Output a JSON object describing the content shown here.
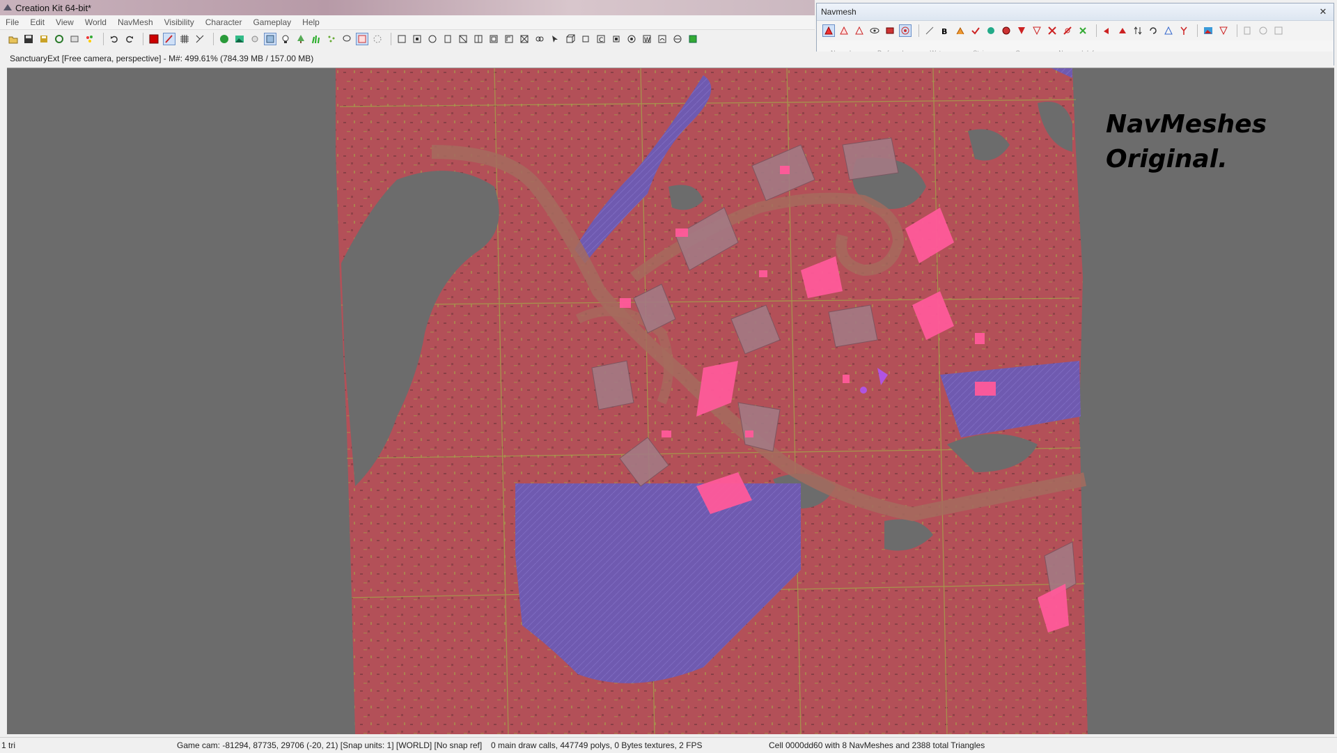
{
  "window": {
    "title": "Creation Kit 64-bit*"
  },
  "menu": {
    "items": [
      "File",
      "Edit",
      "View",
      "World",
      "NavMesh",
      "Visibility",
      "Character",
      "Gameplay",
      "Help"
    ]
  },
  "toolbar": {
    "icons": [
      "open-icon",
      "save-icon",
      "save-all-icon",
      "refresh-icon",
      "preferences-icon",
      "palette-icon",
      "undo-icon",
      "redo-icon",
      "render-window-icon",
      "brush-icon",
      "grid-icon",
      "snap-angle-icon",
      "globe-icon",
      "landscape-icon",
      "light-icon",
      "markers-icon",
      "bulb-icon",
      "tree-icon",
      "grass-icon",
      "particles-icon",
      "lasso-icon",
      "collision-icon",
      "wireframe-icon"
    ]
  },
  "navmesh_window": {
    "title": "Navmesh",
    "close_label": "✕",
    "tabs": [
      "Normal",
      "Preferred",
      "Water",
      "Stairs",
      "Cover",
      "Navmesh Info"
    ]
  },
  "viewport": {
    "header": "SanctuaryExt [Free camera, perspective] - M#: 499.61% (784.39 MB / 157.00 MB)",
    "overlay_line1": "NavMeshes",
    "overlay_line2": "Original.",
    "colors": {
      "background": "#6c6c6c",
      "navmesh": "#b35058",
      "water": "#6f5ab0",
      "preferred": "#ff5a9a",
      "edges": "#a3a34a",
      "road": "#a56b5e"
    }
  },
  "status": {
    "selection": "1 tri",
    "camera": "Game cam: -81294, 87735, 29706 (-20, 21) [Snap units: 1] [WORLD] [No snap ref]",
    "render": "0 main draw calls, 447749 polys, 0 Bytes textures, 2 FPS",
    "cell": "Cell 0000dd60 with 8 NavMeshes and 2388 total Triangles"
  }
}
